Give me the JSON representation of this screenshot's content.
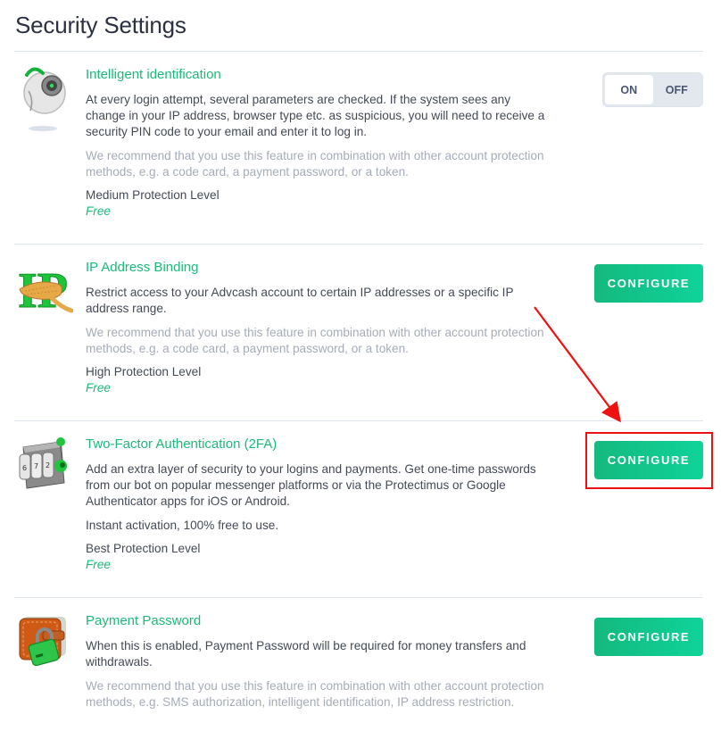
{
  "page": {
    "title": "Security Settings"
  },
  "colors": {
    "accent": "#1cb97a",
    "button_start": "#14b97e",
    "button_end": "#0fd39a",
    "annotation": "#ee1111"
  },
  "sections": [
    {
      "id": "intelligent-identification",
      "icon": "camera-eye-icon",
      "title": "Intelligent identification",
      "description": "At every login attempt, several parameters are checked. If the system sees any change in your IP address, browser type etc. as suspicious, you will need to receive a security PIN code to your email and enter it to log in.",
      "recommendation": "We recommend that you use this feature in combination with other account protection methods, e.g. a code card, a payment password, or a token.",
      "level": "Medium Protection Level",
      "price": "Free",
      "control": {
        "type": "toggle",
        "on_label": "ON",
        "off_label": "OFF",
        "state": "ON"
      }
    },
    {
      "id": "ip-address-binding",
      "icon": "ip-rope-icon",
      "title": "IP Address Binding",
      "description": "Restrict access to your Advcash account to certain IP addresses or a specific IP address range.",
      "recommendation": "We recommend that you use this feature in combination with other account protection methods, e.g. a code card, a payment password, or a token.",
      "level": "High Protection Level",
      "price": "Free",
      "control": {
        "type": "button",
        "label": "CONFIGURE"
      }
    },
    {
      "id": "two-factor-authentication",
      "icon": "combination-lock-icon",
      "title": "Two-Factor Authentication (2FA)",
      "description": "Add an extra layer of security to your logins and payments. Get one-time passwords from our bot on popular messenger platforms or via the Protectimus or Google Authenticator apps for iOS or Android.",
      "note": "Instant activation, 100% free to use.",
      "level": "Best Protection Level",
      "price": "Free",
      "control": {
        "type": "button",
        "label": "CONFIGURE",
        "highlighted": true
      }
    },
    {
      "id": "payment-password",
      "icon": "wallet-padlock-icon",
      "title": "Payment Password",
      "description": "When this is enabled, Payment Password will be required for money transfers and withdrawals.",
      "recommendation": "We recommend that you use this feature in combination with other account protection methods, e.g. SMS authorization, intelligent identification, IP address restriction.",
      "control": {
        "type": "button",
        "label": "CONFIGURE"
      }
    }
  ],
  "annotation": {
    "type": "arrow-and-box",
    "target": "two-factor-authentication configure button"
  }
}
